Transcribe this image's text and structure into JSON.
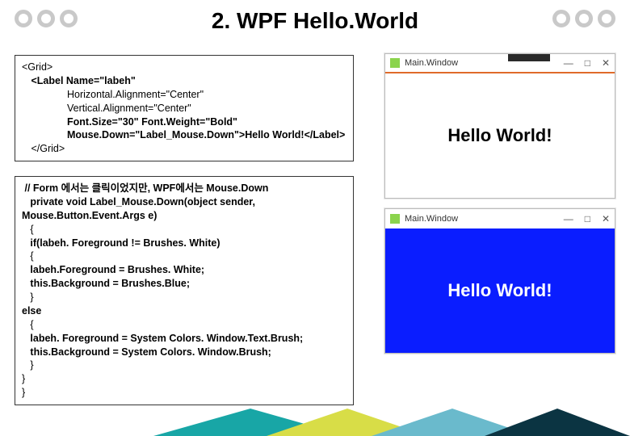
{
  "title": "2. WPF Hello.World",
  "xaml": {
    "l0": "<Grid>",
    "l1": " <Label Name=\"labeh\"",
    "l2": "Horizontal.Alignment=\"Center\"",
    "l3": "Vertical.Alignment=\"Center\"",
    "l4": "Font.Size=\"30\" Font.Weight=\"Bold\"",
    "l5": "Mouse.Down=\"Label_Mouse.Down\">Hello World!</Label>",
    "l6": " </Grid>"
  },
  "cs": {
    "l0": " // Form 에서는 클릭이었지만, WPF에서는 Mouse.Down",
    "l1": "   private void Label_Mouse.Down(object sender, Mouse.Button.Event.Args e)",
    "l2": "   {",
    "l3": "   if(labeh. Foreground != Brushes. White)",
    "l4": "   {",
    "l5": "   labeh.Foreground = Brushes. White;",
    "l6": "   this.Background = Brushes.Blue;",
    "l7": "   }",
    "l8": "else",
    "l9": "   {",
    "l10": "   labeh. Foreground = System Colors. Window.Text.Brush;",
    "l11": "   this.Background = System Colors. Window.Brush;",
    "l12": "   }",
    "l13": "}",
    "l14": "}"
  },
  "window": {
    "title": "Main.Window",
    "min": "—",
    "max": "□",
    "close": "✕",
    "hello": "Hello World!"
  }
}
